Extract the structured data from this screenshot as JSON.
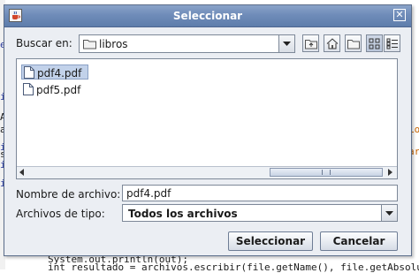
{
  "editor": {
    "fragments": [
      {
        "text": "el",
        "color": "blue"
      },
      {
        "text": "i",
        "color": "blue"
      },
      {
        "text": "i",
        "color": "blue"
      },
      {
        "text": "i",
        "color": "blue"
      },
      {
        "text": "i",
        "color": "blue"
      },
      {
        "text": "A",
        "color": "code"
      },
      {
        "text": "a",
        "color": "code"
      },
      {
        "text": "s",
        "color": "code"
      },
      {
        "text": "Lo",
        "color": "orange"
      },
      {
        "text": "ar",
        "color": "orange"
      },
      {
        "text": "System.out.println(out);",
        "color": "code"
      },
      {
        "text": "int resultado = archivos.escribir(file.getName(), file.getAbsolu",
        "color": "code"
      }
    ]
  },
  "dialog": {
    "title": "Seleccionar",
    "close_glyph": "✕",
    "look_in": {
      "label": "Buscar en:",
      "value": "libros",
      "icon": "folder-icon"
    },
    "toolbar": [
      {
        "name": "up-one-level-button",
        "icon": "folder-up-icon",
        "active": false
      },
      {
        "name": "home-button",
        "icon": "home-icon",
        "active": false
      },
      {
        "name": "new-folder-button",
        "icon": "new-folder-icon",
        "active": false
      },
      {
        "name": "list-view-button",
        "icon": "list-view-icon",
        "active": true
      },
      {
        "name": "details-view-button",
        "icon": "details-view-icon",
        "active": false
      }
    ],
    "files": [
      {
        "name": "pdf4.pdf",
        "icon": "file-icon",
        "selected": true
      },
      {
        "name": "pdf5.pdf",
        "icon": "file-icon",
        "selected": false
      }
    ],
    "file_name": {
      "label": "Nombre de archivo:",
      "value": "pdf4.pdf"
    },
    "file_type": {
      "label": "Archivos de tipo:",
      "value": "Todos los archivos"
    },
    "buttons": {
      "open": "Seleccionar",
      "cancel": "Cancelar"
    }
  },
  "colors": {
    "title_bar": "#6f8cb9",
    "selection": "#c2d2ea",
    "dialog_bg": "#ebeef3"
  }
}
